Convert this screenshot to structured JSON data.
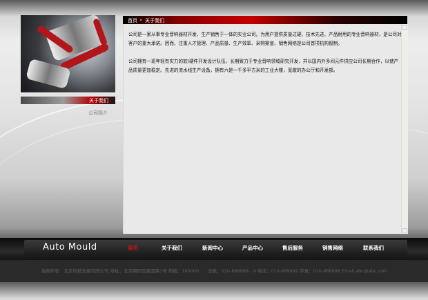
{
  "breadcrumb": {
    "home": "首页",
    "sep": "»",
    "current": "关于我们"
  },
  "sidebar": {
    "title": "关于我们",
    "items": [
      {
        "label": "公司简介"
      }
    ]
  },
  "content": {
    "p1": "公司是一家从事专业音响器材开发、生产销售于一体的实业公司。为用户提供质量过硬、技术先进、产品耐用的专业音响器材，是公司对客户的重大承诺。因而，注重人才管理、产品质量、生产效率、采购渠道、销售网络是公司首项机构智制。",
    "p2": "公司拥有一班年轻有实力的软/硬件开发设计队伍，长期致力于专业音响领域研究开发，并以国内外多间元件供应公司长期合作，以使产品质量更加稳定。先进的流水线生产设备，拥有六是一千多平方米的工业大楼，宽敞的办公厅和开发部。"
  },
  "brand": "Auto Mould",
  "nav": [
    {
      "label": "首页",
      "active": true
    },
    {
      "label": "关于我们"
    },
    {
      "label": "新闻中心"
    },
    {
      "label": "产品中心"
    },
    {
      "label": "售后服务"
    },
    {
      "label": "销售网络"
    },
    {
      "label": "联系我们"
    }
  ],
  "footer": {
    "text": "版权所有　北京科技发展有限公司 地址：北京朝阳区建国路1号 邮编：100000　　总机：010-888888 - 9 电话：010-999999 传真：010-888888 Email abc@abc.com"
  },
  "colors": {
    "accent": "#cc1111",
    "nav_bg": "#1a1a1a"
  }
}
